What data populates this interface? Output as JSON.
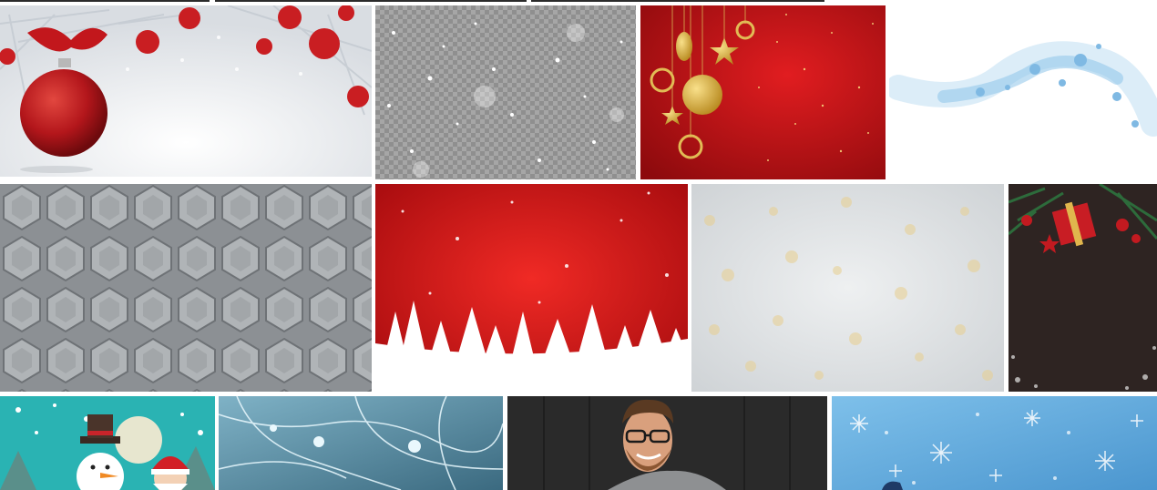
{
  "gallery": {
    "rows": [
      {
        "tiles": [
          {
            "subject": "christmas-ornament-silver-fir-branches",
            "accent": "#b71c1c"
          },
          {
            "subject": "falling-snow-transparent-checkerboard",
            "accent": "#9a9a9a"
          },
          {
            "subject": "gold-ornaments-on-red-glitter",
            "accent": "#c0141a"
          },
          {
            "subject": "blue-snowflake-swirl-on-white",
            "accent": "#8ec5ea"
          }
        ]
      },
      {
        "tiles": [
          {
            "subject": "gray-3d-hexagon-wall",
            "accent": "#9ea2a5"
          },
          {
            "subject": "red-snowflakes-white-fir-silhouettes",
            "accent": "#d61818"
          },
          {
            "subject": "golden-bokeh-light-background",
            "accent": "#d9d4c8"
          },
          {
            "subject": "christmas-gifts-on-dark-board",
            "accent": "#2e2422"
          }
        ]
      },
      {
        "tiles": [
          {
            "subject": "snowman-and-santa-cartoon",
            "accent": "#2ab3b3"
          },
          {
            "subject": "blue-neuron-network",
            "accent": "#4a7d93"
          },
          {
            "subject": "smiling-bearded-man-glasses",
            "accent": "#2a2a2a"
          },
          {
            "subject": "blue-snowflakes-background",
            "accent": "#5ea8dc"
          }
        ]
      }
    ]
  }
}
